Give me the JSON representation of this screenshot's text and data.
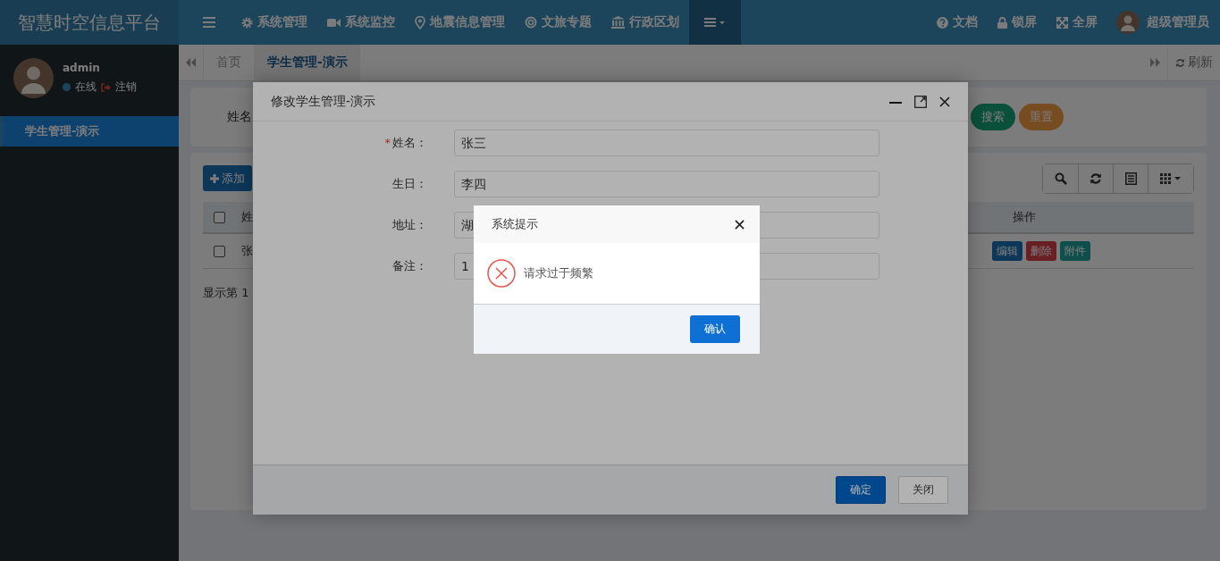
{
  "header": {
    "title": "智慧时空信息平台",
    "nav": [
      {
        "label": "系统管理"
      },
      {
        "label": "系统监控"
      },
      {
        "label": "地震信息管理"
      },
      {
        "label": "文旅专题"
      },
      {
        "label": "行政区划"
      }
    ],
    "more_menu": {
      "selected": true
    },
    "tools": [
      {
        "label": "文档"
      },
      {
        "label": "锁屏"
      },
      {
        "label": "全屏"
      }
    ],
    "user": "超级管理员"
  },
  "sidebar": {
    "user": "admin",
    "status": "在线",
    "logout": "注销",
    "items": [
      {
        "label": "学生管理-演示",
        "selected": true
      }
    ]
  },
  "tabs": [
    {
      "label": "首页",
      "selected": false
    },
    {
      "label": "学生管理-演示",
      "selected": true
    }
  ],
  "refresh": "刷新",
  "search": {
    "label": "姓名",
    "buttons": [
      "搜索",
      "重置"
    ]
  },
  "table": {
    "add": "添加",
    "header_checked": false,
    "columns": [
      "姓",
      "操作"
    ],
    "rows": [
      {
        "checked": false,
        "cell": "张",
        "actions": [
          "编辑",
          "删除",
          "附件"
        ]
      }
    ],
    "footer": "显示第 1"
  },
  "dialog": {
    "title": "修改学生管理-演示",
    "required_mark": "*",
    "fields": [
      {
        "label": "姓名：",
        "required": true,
        "value": "张三"
      },
      {
        "label": "生日：",
        "required": false,
        "value": "李四"
      },
      {
        "label": "地址：",
        "required": false,
        "value": "湖"
      },
      {
        "label": "备注：",
        "required": false,
        "value": "1"
      }
    ],
    "buttons": [
      "确定",
      "关闭"
    ]
  },
  "alert": {
    "title": "系统提示",
    "message": "请求过于频繁",
    "button": "确认"
  }
}
